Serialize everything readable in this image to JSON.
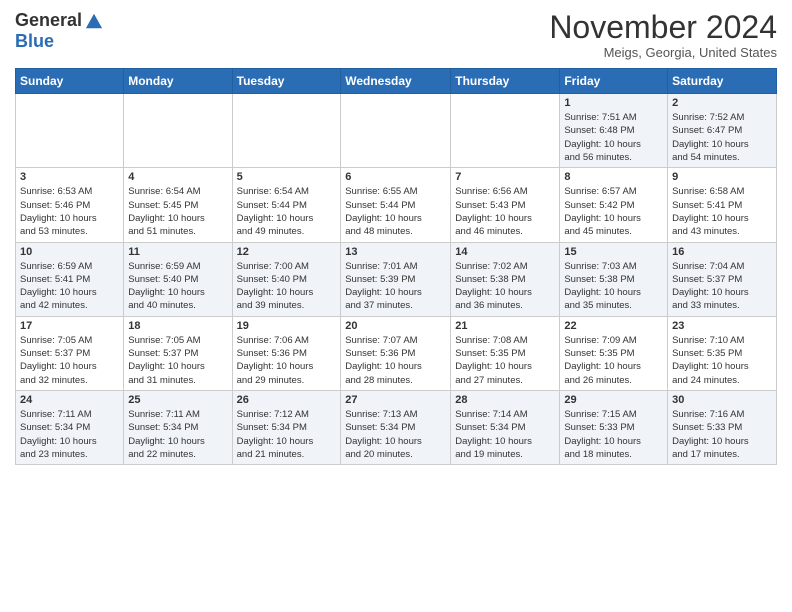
{
  "header": {
    "logo_general": "General",
    "logo_blue": "Blue",
    "month_title": "November 2024",
    "location": "Meigs, Georgia, United States"
  },
  "weekdays": [
    "Sunday",
    "Monday",
    "Tuesday",
    "Wednesday",
    "Thursday",
    "Friday",
    "Saturday"
  ],
  "weeks": [
    [
      {
        "day": "",
        "info": ""
      },
      {
        "day": "",
        "info": ""
      },
      {
        "day": "",
        "info": ""
      },
      {
        "day": "",
        "info": ""
      },
      {
        "day": "",
        "info": ""
      },
      {
        "day": "1",
        "info": "Sunrise: 7:51 AM\nSunset: 6:48 PM\nDaylight: 10 hours\nand 56 minutes."
      },
      {
        "day": "2",
        "info": "Sunrise: 7:52 AM\nSunset: 6:47 PM\nDaylight: 10 hours\nand 54 minutes."
      }
    ],
    [
      {
        "day": "3",
        "info": "Sunrise: 6:53 AM\nSunset: 5:46 PM\nDaylight: 10 hours\nand 53 minutes."
      },
      {
        "day": "4",
        "info": "Sunrise: 6:54 AM\nSunset: 5:45 PM\nDaylight: 10 hours\nand 51 minutes."
      },
      {
        "day": "5",
        "info": "Sunrise: 6:54 AM\nSunset: 5:44 PM\nDaylight: 10 hours\nand 49 minutes."
      },
      {
        "day": "6",
        "info": "Sunrise: 6:55 AM\nSunset: 5:44 PM\nDaylight: 10 hours\nand 48 minutes."
      },
      {
        "day": "7",
        "info": "Sunrise: 6:56 AM\nSunset: 5:43 PM\nDaylight: 10 hours\nand 46 minutes."
      },
      {
        "day": "8",
        "info": "Sunrise: 6:57 AM\nSunset: 5:42 PM\nDaylight: 10 hours\nand 45 minutes."
      },
      {
        "day": "9",
        "info": "Sunrise: 6:58 AM\nSunset: 5:41 PM\nDaylight: 10 hours\nand 43 minutes."
      }
    ],
    [
      {
        "day": "10",
        "info": "Sunrise: 6:59 AM\nSunset: 5:41 PM\nDaylight: 10 hours\nand 42 minutes."
      },
      {
        "day": "11",
        "info": "Sunrise: 6:59 AM\nSunset: 5:40 PM\nDaylight: 10 hours\nand 40 minutes."
      },
      {
        "day": "12",
        "info": "Sunrise: 7:00 AM\nSunset: 5:40 PM\nDaylight: 10 hours\nand 39 minutes."
      },
      {
        "day": "13",
        "info": "Sunrise: 7:01 AM\nSunset: 5:39 PM\nDaylight: 10 hours\nand 37 minutes."
      },
      {
        "day": "14",
        "info": "Sunrise: 7:02 AM\nSunset: 5:38 PM\nDaylight: 10 hours\nand 36 minutes."
      },
      {
        "day": "15",
        "info": "Sunrise: 7:03 AM\nSunset: 5:38 PM\nDaylight: 10 hours\nand 35 minutes."
      },
      {
        "day": "16",
        "info": "Sunrise: 7:04 AM\nSunset: 5:37 PM\nDaylight: 10 hours\nand 33 minutes."
      }
    ],
    [
      {
        "day": "17",
        "info": "Sunrise: 7:05 AM\nSunset: 5:37 PM\nDaylight: 10 hours\nand 32 minutes."
      },
      {
        "day": "18",
        "info": "Sunrise: 7:05 AM\nSunset: 5:37 PM\nDaylight: 10 hours\nand 31 minutes."
      },
      {
        "day": "19",
        "info": "Sunrise: 7:06 AM\nSunset: 5:36 PM\nDaylight: 10 hours\nand 29 minutes."
      },
      {
        "day": "20",
        "info": "Sunrise: 7:07 AM\nSunset: 5:36 PM\nDaylight: 10 hours\nand 28 minutes."
      },
      {
        "day": "21",
        "info": "Sunrise: 7:08 AM\nSunset: 5:35 PM\nDaylight: 10 hours\nand 27 minutes."
      },
      {
        "day": "22",
        "info": "Sunrise: 7:09 AM\nSunset: 5:35 PM\nDaylight: 10 hours\nand 26 minutes."
      },
      {
        "day": "23",
        "info": "Sunrise: 7:10 AM\nSunset: 5:35 PM\nDaylight: 10 hours\nand 24 minutes."
      }
    ],
    [
      {
        "day": "24",
        "info": "Sunrise: 7:11 AM\nSunset: 5:34 PM\nDaylight: 10 hours\nand 23 minutes."
      },
      {
        "day": "25",
        "info": "Sunrise: 7:11 AM\nSunset: 5:34 PM\nDaylight: 10 hours\nand 22 minutes."
      },
      {
        "day": "26",
        "info": "Sunrise: 7:12 AM\nSunset: 5:34 PM\nDaylight: 10 hours\nand 21 minutes."
      },
      {
        "day": "27",
        "info": "Sunrise: 7:13 AM\nSunset: 5:34 PM\nDaylight: 10 hours\nand 20 minutes."
      },
      {
        "day": "28",
        "info": "Sunrise: 7:14 AM\nSunset: 5:34 PM\nDaylight: 10 hours\nand 19 minutes."
      },
      {
        "day": "29",
        "info": "Sunrise: 7:15 AM\nSunset: 5:33 PM\nDaylight: 10 hours\nand 18 minutes."
      },
      {
        "day": "30",
        "info": "Sunrise: 7:16 AM\nSunset: 5:33 PM\nDaylight: 10 hours\nand 17 minutes."
      }
    ]
  ]
}
